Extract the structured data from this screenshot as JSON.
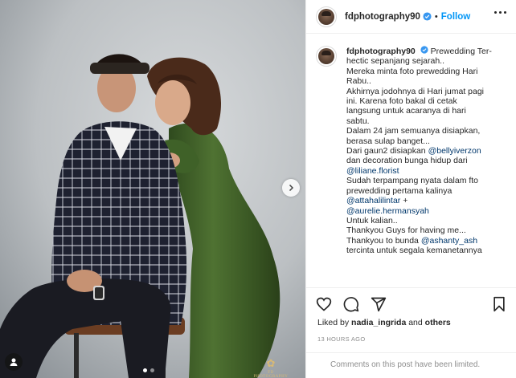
{
  "post": {
    "username": "fdphotography90",
    "follow_label": "Follow",
    "separator": "•",
    "caption_lines": [
      "Prewedding Ter-",
      "hectic sepanjang sejarah..",
      "Mereka minta foto prewedding Hari",
      "Rabu..",
      "Akhirnya jodohnya di Hari jumat pagi",
      "ini. Karena foto bakal di cetak",
      "langsung untuk acaranya di hari",
      "sabtu.",
      "Dalam 24 jam semuanya disiapkan,",
      "berasa sulap banget...",
      "Dari gaun2 disiapkan ",
      "dan decoration bunga hidup dari",
      "",
      "Sudah terpampang nyata dalam fto",
      "prewedding pertama kalinya",
      " +",
      "",
      "Untuk kalian..",
      "Thankyou Guys for having me...",
      "Thankyou to bunda ",
      "tercinta untuk segala kemanetannya"
    ],
    "mentions": {
      "bellyiverzon": "@bellyiverzon",
      "liliane_florist": "@liliane.florist",
      "attahalilintar": "@attahalilintar",
      "aurelie": "@aurelie.hermansyah",
      "ashanty": "@ashanty_ash"
    },
    "likes_prefix": "Liked by ",
    "likes_user": "nadia_ingrida",
    "likes_and": " and ",
    "likes_others": "others",
    "timestamp": "13 HOURS AGO",
    "comments_limited": "Comments on this post have been limited."
  },
  "photo": {
    "watermark_mark": "✿",
    "watermark_text": "FD PHOTOGRAPHY",
    "slide_count": 2,
    "active_slide": 1
  },
  "icons": {
    "verified": "verified-badge-icon",
    "more": "more-options-icon",
    "like": "heart-icon",
    "comment": "comment-bubble-icon",
    "share": "paper-plane-icon",
    "save": "bookmark-icon",
    "next": "chevron-right-icon",
    "tagged": "user-tag-icon"
  },
  "colors": {
    "link_blue": "#0095f6",
    "mention_blue": "#00376b",
    "muted_gray": "#8e8e8e",
    "text": "#262626"
  }
}
